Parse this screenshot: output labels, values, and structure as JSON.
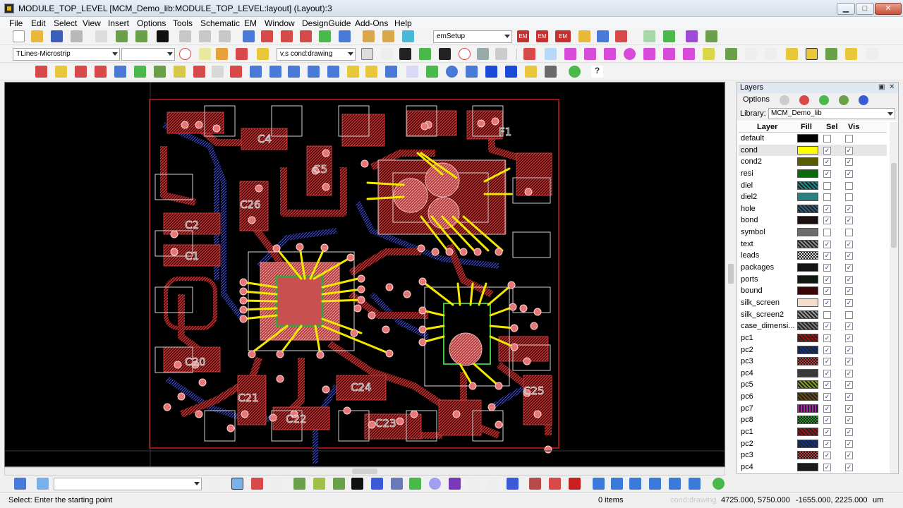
{
  "window": {
    "title": "MODULE_TOP_LEVEL [MCM_Demo_lib:MODULE_TOP_LEVEL:layout] (Layout):3",
    "minimize": "▁",
    "maximize": "□",
    "close": "✕"
  },
  "menu": [
    "File",
    "Edit",
    "Select",
    "View",
    "Insert",
    "Options",
    "Tools",
    "Schematic",
    "EM",
    "Window",
    "DesignGuide",
    "Add-Ons",
    "Help"
  ],
  "toolbar1": {
    "setup_combo": "emSetup",
    "em_buttons": [
      "EM",
      "EM",
      "EM"
    ]
  },
  "toolbar2": {
    "palette_combo": "TLines-Microstrip",
    "blank_combo": "",
    "layer_combo": "v,s cond:drawing"
  },
  "canvas": {
    "background": "#000000",
    "component_labels": [
      "C4",
      "C5",
      "C26",
      "C2",
      "C1",
      "F1",
      "C20",
      "C21",
      "C22",
      "C23",
      "C24",
      "C25"
    ]
  },
  "layers_panel": {
    "title": "Layers",
    "options_label": "Options",
    "library_label": "Library:",
    "library_value": "MCM_Demo_lib",
    "columns": [
      "Layer",
      "Fill",
      "Sel",
      "Vis"
    ],
    "rows": [
      {
        "name": "default",
        "color": "#000000",
        "pattern": "solid",
        "sel": false,
        "vis": false
      },
      {
        "name": "cond",
        "color": "#ffff00",
        "pattern": "solid",
        "sel": true,
        "vis": true,
        "selected": true
      },
      {
        "name": "cond2",
        "color": "#5b5b00",
        "pattern": "solid",
        "sel": true,
        "vis": true
      },
      {
        "name": "resi",
        "color": "#0a6a0a",
        "pattern": "solid",
        "sel": true,
        "vis": true
      },
      {
        "name": "diel",
        "color": "#1a8a8a",
        "pattern": "hatch",
        "sel": false,
        "vis": false
      },
      {
        "name": "diel2",
        "color": "#2a7f7f",
        "pattern": "solid",
        "sel": false,
        "vis": false
      },
      {
        "name": "hole",
        "color": "#2f5f7f",
        "pattern": "hatch",
        "sel": true,
        "vis": true
      },
      {
        "name": "bond",
        "color": "#1c1010",
        "pattern": "solid",
        "sel": true,
        "vis": true
      },
      {
        "name": "symbol",
        "color": "#6c6c6c",
        "pattern": "solid",
        "sel": false,
        "vis": false
      },
      {
        "name": "text",
        "color": "#8c8c8c",
        "pattern": "hatch",
        "sel": true,
        "vis": true
      },
      {
        "name": "leads",
        "color": "#dcdcdc",
        "pattern": "check",
        "sel": true,
        "vis": true
      },
      {
        "name": "packages",
        "color": "#141414",
        "pattern": "solid",
        "sel": true,
        "vis": true
      },
      {
        "name": "ports",
        "color": "#0f1a0f",
        "pattern": "solid",
        "sel": true,
        "vis": true
      },
      {
        "name": "bound",
        "color": "#3a0606",
        "pattern": "solid",
        "sel": true,
        "vis": true
      },
      {
        "name": "silk_screen",
        "color": "#f5dccb",
        "pattern": "solid",
        "sel": true,
        "vis": true
      },
      {
        "name": "silk_screen2",
        "color": "#9a9a9a",
        "pattern": "hatch",
        "sel": false,
        "vis": false
      },
      {
        "name": "case_dimensi...",
        "color": "#7a7a7a",
        "pattern": "hatch",
        "sel": true,
        "vis": true
      },
      {
        "name": "pc1",
        "color": "#a01010",
        "pattern": "hatch",
        "sel": true,
        "vis": true
      },
      {
        "name": "pc2",
        "color": "#10308a",
        "pattern": "hatch",
        "sel": true,
        "vis": true
      },
      {
        "name": "pc3",
        "color": "#c04040",
        "pattern": "check",
        "sel": true,
        "vis": true
      },
      {
        "name": "pc4",
        "color": "#3a3a3a",
        "pattern": "solid",
        "sel": true,
        "vis": true
      },
      {
        "name": "pc5",
        "color": "#7fa020",
        "pattern": "hatch",
        "sel": true,
        "vis": true
      },
      {
        "name": "pc6",
        "color": "#6a4a10",
        "pattern": "hatch",
        "sel": true,
        "vis": true
      },
      {
        "name": "pc7",
        "color": "#b020b0",
        "pattern": "stripe",
        "sel": true,
        "vis": true
      },
      {
        "name": "pc8",
        "color": "#20a020",
        "pattern": "check",
        "sel": true,
        "vis": true
      },
      {
        "name": "pc1",
        "color": "#a01010",
        "pattern": "hatch",
        "sel": true,
        "vis": true
      },
      {
        "name": "pc2",
        "color": "#10308a",
        "pattern": "hatch",
        "sel": true,
        "vis": true
      },
      {
        "name": "pc3",
        "color": "#c04040",
        "pattern": "check",
        "sel": true,
        "vis": true
      },
      {
        "name": "pc4",
        "color": "#1a1a1a",
        "pattern": "solid",
        "sel": true,
        "vis": true
      }
    ]
  },
  "status": {
    "prompt": "Select: Enter the starting point",
    "items": "0 items",
    "layer": "cond:drawing",
    "coords1": "4725.000, 5750.000",
    "coords2": "-1655.000, 2225.000",
    "units": "um"
  }
}
